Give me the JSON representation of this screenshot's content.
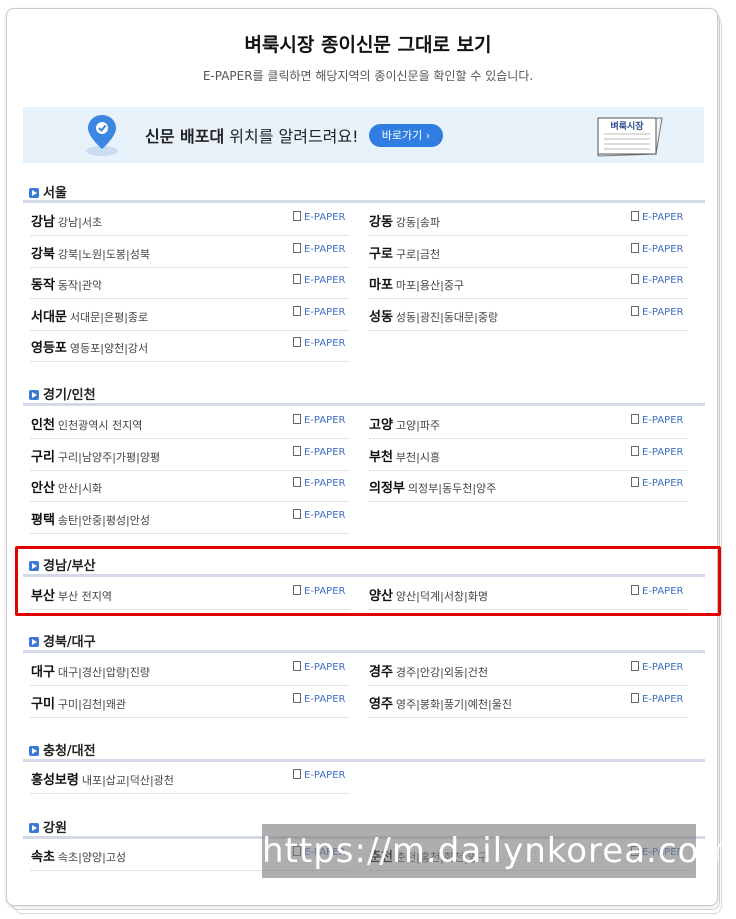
{
  "header": {
    "title": "벼룩시장 종이신문 그대로 보기",
    "subtitle": "E-PAPER를 클릭하면 해당지역의 종이신문을 확인할 수 있습니다."
  },
  "banner": {
    "text_bold": "신문 배포대",
    "text_rest": " 위치를 알려드려요!",
    "button_label": "바로가기 ›",
    "paper_label": "벼룩시장"
  },
  "epaper_label": "E-PAPER",
  "sections": [
    {
      "title": "서울",
      "rows": [
        {
          "name": "강남",
          "sub": "강남|서초"
        },
        {
          "name": "강동",
          "sub": "강동|송파"
        },
        {
          "name": "강북",
          "sub": "강북|노원|도봉|성북"
        },
        {
          "name": "구로",
          "sub": "구로|금천"
        },
        {
          "name": "동작",
          "sub": "동작|관악"
        },
        {
          "name": "마포",
          "sub": "마포|용산|중구"
        },
        {
          "name": "서대문",
          "sub": "서대문|은평|종로"
        },
        {
          "name": "성동",
          "sub": "성동|광진|동대문|중랑"
        },
        {
          "name": "영등포",
          "sub": "영등포|양천|강서"
        }
      ]
    },
    {
      "title": "경기/인천",
      "rows": [
        {
          "name": "인천",
          "sub": "인천광역시 전지역"
        },
        {
          "name": "고양",
          "sub": "고양|파주"
        },
        {
          "name": "구리",
          "sub": "구리|남양주|가평|양평"
        },
        {
          "name": "부천",
          "sub": "부천|시흥"
        },
        {
          "name": "안산",
          "sub": "안산|시화"
        },
        {
          "name": "의정부",
          "sub": "의정부|동두천|양주"
        },
        {
          "name": "평택",
          "sub": "송탄|안중|평성|안성"
        }
      ]
    },
    {
      "title": "경남/부산",
      "rows": [
        {
          "name": "부산",
          "sub": "부산 전지역"
        },
        {
          "name": "양산",
          "sub": "양산|덕계|서창|화명"
        }
      ]
    },
    {
      "title": "경북/대구",
      "rows": [
        {
          "name": "대구",
          "sub": "대구|경산|압량|진량"
        },
        {
          "name": "경주",
          "sub": "경주|안강|외동|건천"
        },
        {
          "name": "구미",
          "sub": "구미|김천|왜관"
        },
        {
          "name": "영주",
          "sub": "영주|봉화|풍기|예천|울진"
        }
      ]
    },
    {
      "title": "충청/대전",
      "rows": [
        {
          "name": "홍성보령",
          "sub": "내포|삽교|덕산|광천"
        }
      ]
    },
    {
      "title": "강원",
      "rows": [
        {
          "name": "속초",
          "sub": "속초|양양|고성"
        },
        {
          "name": "춘천",
          "sub": "춘천|홍천|화천|양구"
        }
      ]
    }
  ],
  "watermark": "https://m.dailynkorea.com",
  "colors": {
    "accent": "#2f7de1",
    "banner_bg": "#e8f2fb",
    "highlight": "#e00000",
    "section_icon": "#3b78d8"
  }
}
